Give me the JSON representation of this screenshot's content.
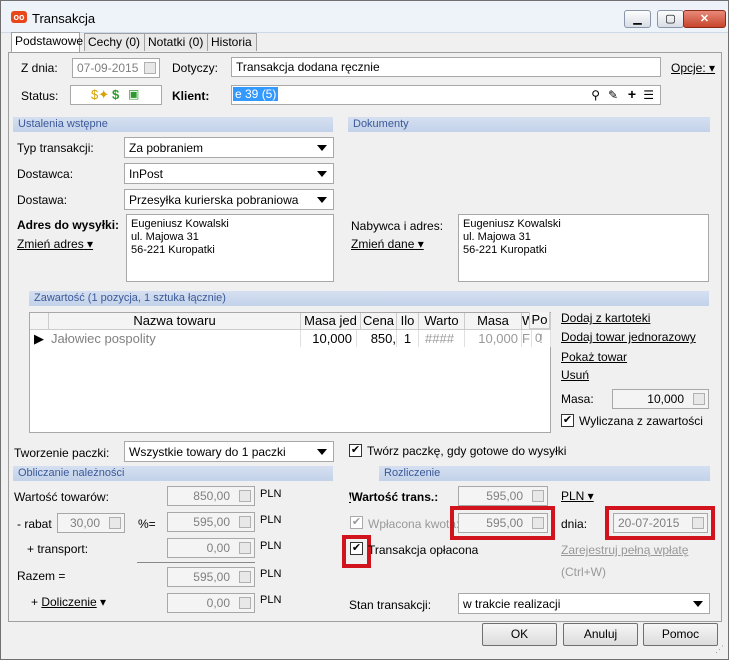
{
  "window": {
    "title": "Transakcja",
    "icon": "app-logo-icon"
  },
  "tabs": [
    "Podstawowe",
    "Cechy (0)",
    "Notatki (0)",
    "Historia"
  ],
  "header": {
    "date_label": "Z dnia:",
    "date_value": "07-09-2015",
    "concerns_label": "Dotyczy:",
    "concerns_value": "Transakcja dodana ręcznie",
    "options_label": "Opcje:",
    "status_label": "Status:",
    "client_label": "Klient:",
    "client_value": "e 39 (5)"
  },
  "prelim": {
    "section": "Ustalenia wstępne",
    "type_label": "Typ transakcji:",
    "type_value": "Za pobraniem",
    "supplier_label": "Dostawca:",
    "supplier_value": "InPost",
    "delivery_label": "Dostawa:",
    "delivery_value": "Przesyłka kurierska pobraniowa",
    "address_label": "Adres do wysyłki:",
    "change_address": "Zmień adres",
    "address": "Eugeniusz Kowalski\nul. Majowa 31\n56-221 Kuropatki"
  },
  "documents": {
    "section": "Dokumenty",
    "buyer_label": "Nabywca i adres:",
    "change_data": "Zmień dane",
    "address": "Eugeniusz Kowalski\nul. Majowa 31\n56-221 Kuropatki"
  },
  "contents": {
    "section": "Zawartość (1 pozycja, 1 sztuka łącznie)",
    "columns": [
      "Nazwa towaru",
      "Masa jed",
      "Cena",
      "Ilo",
      "Warto",
      "Masa",
      "W",
      "W",
      "Po"
    ],
    "row": [
      "Jałowiec pospolity",
      "10,000",
      "850,",
      "1",
      "####",
      "10,000",
      "F",
      "!",
      "0"
    ],
    "actions": {
      "add_from_catalog": "Dodaj z kartoteki",
      "add_one_time": "Dodaj towar jednorazowy",
      "show_item": "Pokaż towar",
      "remove": "Usuń"
    },
    "mass_label": "Masa:",
    "mass_value": "10,000",
    "calc_label": "Wyliczana z zawartości"
  },
  "packaging": {
    "label": "Tworzenie paczki:",
    "value": "Wszystkie towary do 1 paczki",
    "create_label": "Twórz paczkę, gdy gotowe do wysyłki"
  },
  "charges": {
    "section": "Obliczanie należności",
    "goods_label": "Wartość towarów:",
    "goods_value": "850,00",
    "discount_label": "- rabat",
    "discount_value": "30,00",
    "percent_eq": "%=",
    "discounted_value": "595,00",
    "transport_label": "+ transport:",
    "transport_value": "0,00",
    "total_label": "Razem =",
    "total_value": "595,00",
    "extra_label": "Doliczenie",
    "extra_value": "0,00",
    "currency": "PLN"
  },
  "settlement": {
    "section": "Rozliczenie",
    "trans_value_label": "Wartość trans.:",
    "trans_value": "595,00",
    "currency": "PLN",
    "paid_label": "Wpłacona kwota:",
    "paid_value": "595,00",
    "day_label": "dnia:",
    "day_value": "20-07-2015",
    "paid_check_label": "Transakcja opłacona",
    "register_link": "Zarejestruj pełną wpłatę",
    "shortcut": "(Ctrl+W)"
  },
  "state": {
    "label": "Stan transakcji:",
    "value": "w trakcie realizacji"
  },
  "buttons": {
    "ok": "OK",
    "cancel": "Anuluj",
    "help": "Pomoc"
  }
}
